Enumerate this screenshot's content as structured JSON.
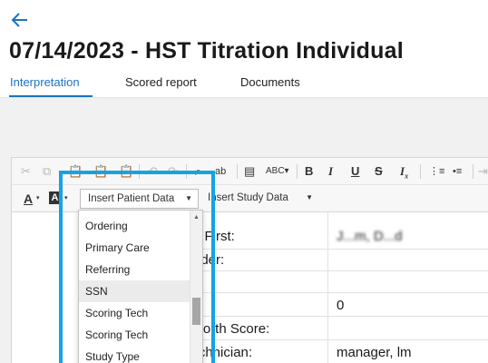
{
  "header": {
    "back_icon": "arrow-left-icon",
    "title": "07/14/2023 - HST Titration Individual"
  },
  "tabs": [
    {
      "label": "Interpretation",
      "active": true
    },
    {
      "label": "Scored report",
      "active": false
    },
    {
      "label": "Documents",
      "active": false
    }
  ],
  "toolbar": {
    "row1_icons": [
      "cut-icon",
      "copy-icon",
      "paste-icon",
      "paste-text-icon",
      "paste-word-icon",
      "undo-icon",
      "redo-icon",
      "find-icon",
      "replace-icon",
      "select-all-icon",
      "spellcheck-icon",
      "bold-icon",
      "italic-icon",
      "underline-icon",
      "strikethrough-icon",
      "remove-format-icon",
      "numbered-list-icon",
      "bulleted-list-icon",
      "indent-icon"
    ],
    "font_color_label": "A",
    "bg_color_label": "A",
    "insert_patient_data": "Insert Patient Data",
    "insert_study_data": "Insert Study Data"
  },
  "dropdown": {
    "items": [
      "Ordering",
      "Primary Care",
      "Referring",
      "SSN",
      "Scoring Tech",
      "Scoring Tech",
      "Study Type"
    ],
    "hovered_index": 3
  },
  "table": {
    "rows": [
      {
        "label": "t, First:",
        "value": "J...m, D...d"
      },
      {
        "label": "nder:",
        "value": ""
      },
      {
        "label": "N",
        "value": ""
      },
      {
        "label": ":",
        "value": "0"
      },
      {
        "label": "worth Score:",
        "value": ""
      },
      {
        "label": "Technician:",
        "value": "manager, lm"
      }
    ]
  },
  "colors": {
    "accent": "#1a73c7",
    "highlight_border": "#16a2e4"
  }
}
